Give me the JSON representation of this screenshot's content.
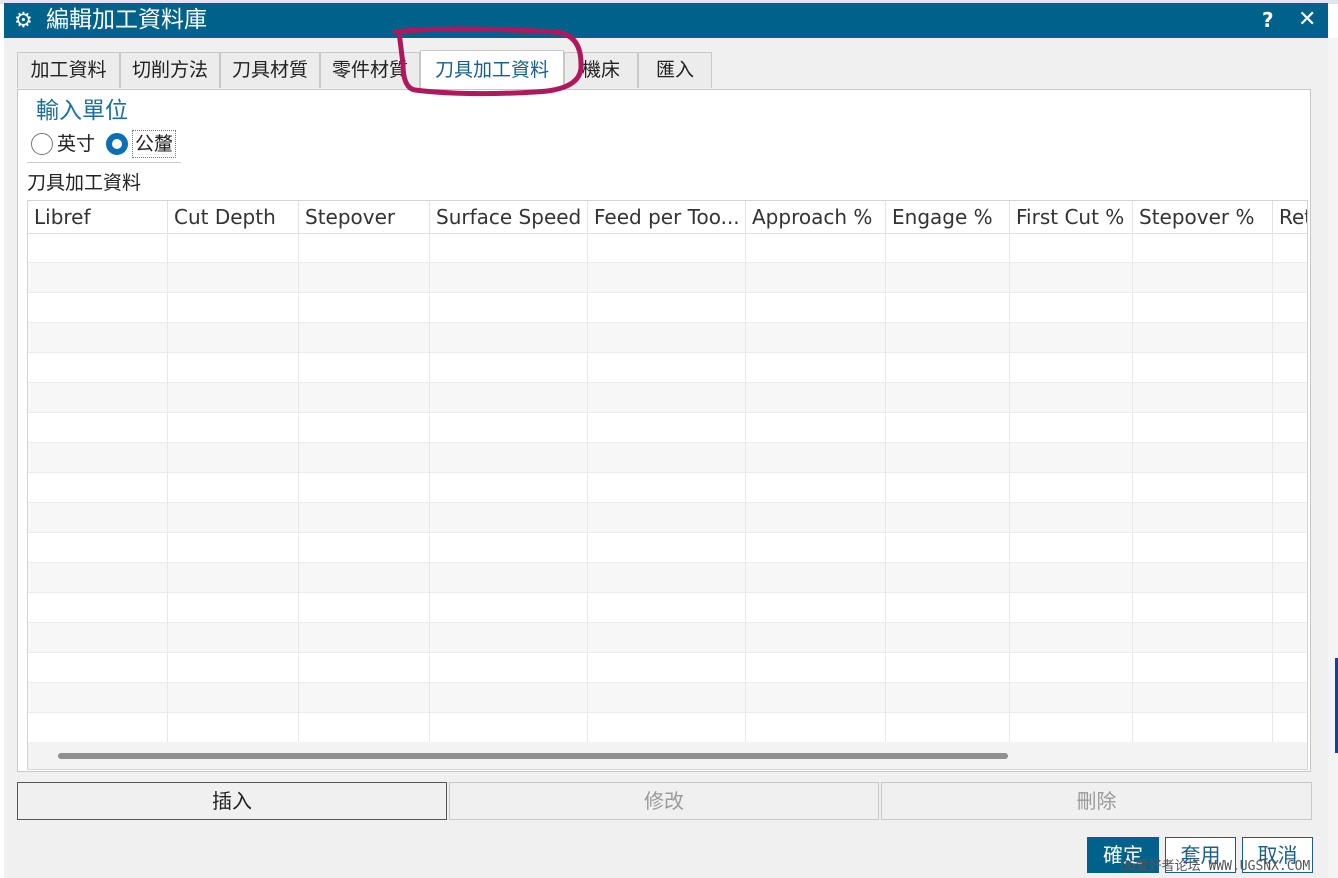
{
  "dialog": {
    "title": "編輯加工資料庫",
    "help_label": "?",
    "close_label": "✕",
    "gear_glyph": "⚙"
  },
  "tabs": [
    {
      "label": "加工資料"
    },
    {
      "label": "切削方法"
    },
    {
      "label": "刀具材質"
    },
    {
      "label": "零件材質"
    },
    {
      "label": "刀具加工資料"
    },
    {
      "label": "機床"
    },
    {
      "label": "匯入"
    }
  ],
  "active_tab_index": 4,
  "units": {
    "title": "輸入單位",
    "options": [
      "英寸",
      "公釐"
    ],
    "selected": "公釐"
  },
  "section_label": "刀具加工資料",
  "table": {
    "columns": [
      "Libref",
      "Cut Depth",
      "Stepover",
      "Surface Speed",
      "Feed per Too...",
      "Approach %",
      "Engage %",
      "First Cut %",
      "Stepover %",
      "Ret"
    ],
    "row_count": 17
  },
  "actions": {
    "insert": "插入",
    "modify": "修改",
    "delete": "刪除"
  },
  "footer": {
    "ok": "確定",
    "apply": "套用",
    "cancel": "取消"
  },
  "watermark": "UG爱好者论坛 WWW.UGSNX.COM",
  "colors": {
    "titlebar": "#00618a",
    "accent": "#0a6fb5",
    "annotation": "#b0185e"
  }
}
